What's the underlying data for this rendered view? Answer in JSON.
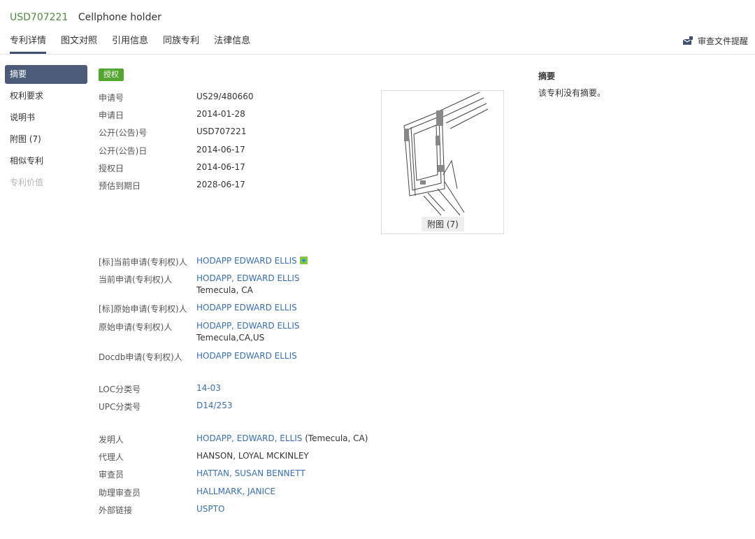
{
  "header": {
    "pub_no": "USD707221",
    "name": "Cellphone holder",
    "watch_label": "审查文件提醒"
  },
  "tabs": [
    {
      "label": "专利详情"
    },
    {
      "label": "图文对照"
    },
    {
      "label": "引用信息"
    },
    {
      "label": "同族专利"
    },
    {
      "label": "法律信息"
    }
  ],
  "sidebar": {
    "items": [
      {
        "label": "摘要"
      },
      {
        "label": "权利要求"
      },
      {
        "label": "说明书"
      },
      {
        "label": "附图 (7)"
      },
      {
        "label": "相似专利"
      },
      {
        "label": "专利价值"
      }
    ]
  },
  "status": "授权",
  "basic": {
    "app_no": {
      "label": "申请号",
      "value": "US29/480660"
    },
    "app_date": {
      "label": "申请日",
      "value": "2014-01-28"
    },
    "pub_no": {
      "label": "公开(公告)号",
      "value": "USD707221"
    },
    "pub_date": {
      "label": "公开(公告)日",
      "value": "2014-06-17"
    },
    "grant_date": {
      "label": "授权日",
      "value": "2014-06-17"
    },
    "expiry": {
      "label": "预估到期日",
      "value": "2028-06-17"
    }
  },
  "figure": {
    "label": "附图 (7)"
  },
  "parties": {
    "std_current": {
      "label": "[标]当前申请(专利权)人",
      "value": "HODAPP EDWARD ELLIS"
    },
    "current": {
      "label": "当前申请(专利权)人",
      "value": "HODAPP, EDWARD ELLIS",
      "sub": "Temecula, CA"
    },
    "std_original": {
      "label": "[标]原始申请(专利权)人",
      "value": "HODAPP EDWARD ELLIS"
    },
    "original": {
      "label": "原始申请(专利权)人",
      "value": "HODAPP, EDWARD ELLIS",
      "sub": "Temecula,CA,US"
    },
    "docdb": {
      "label": "Docdb申请(专利权)人",
      "value": "HODAPP EDWARD ELLIS"
    }
  },
  "classes": {
    "loc": {
      "label": "LOC分类号",
      "value": "14-03"
    },
    "upc": {
      "label": "UPC分类号",
      "value": "D14/253"
    }
  },
  "people": {
    "inventor": {
      "label": "发明人",
      "value": "HODAPP, EDWARD, ELLIS",
      "extra": " (Temecula, CA)"
    },
    "agent": {
      "label": "代理人",
      "value": "HANSON, LOYAL MCKINLEY"
    },
    "examiner": {
      "label": "审查员",
      "value": "HATTAN, SUSAN BENNETT"
    },
    "asst_examiner": {
      "label": "助理审查员",
      "value": "HALLMARK, JANICE"
    },
    "ext_link": {
      "label": "外部链接",
      "value": "USPTO"
    }
  },
  "abstract": {
    "title": "摘要",
    "text": "该专利没有摘要。"
  }
}
